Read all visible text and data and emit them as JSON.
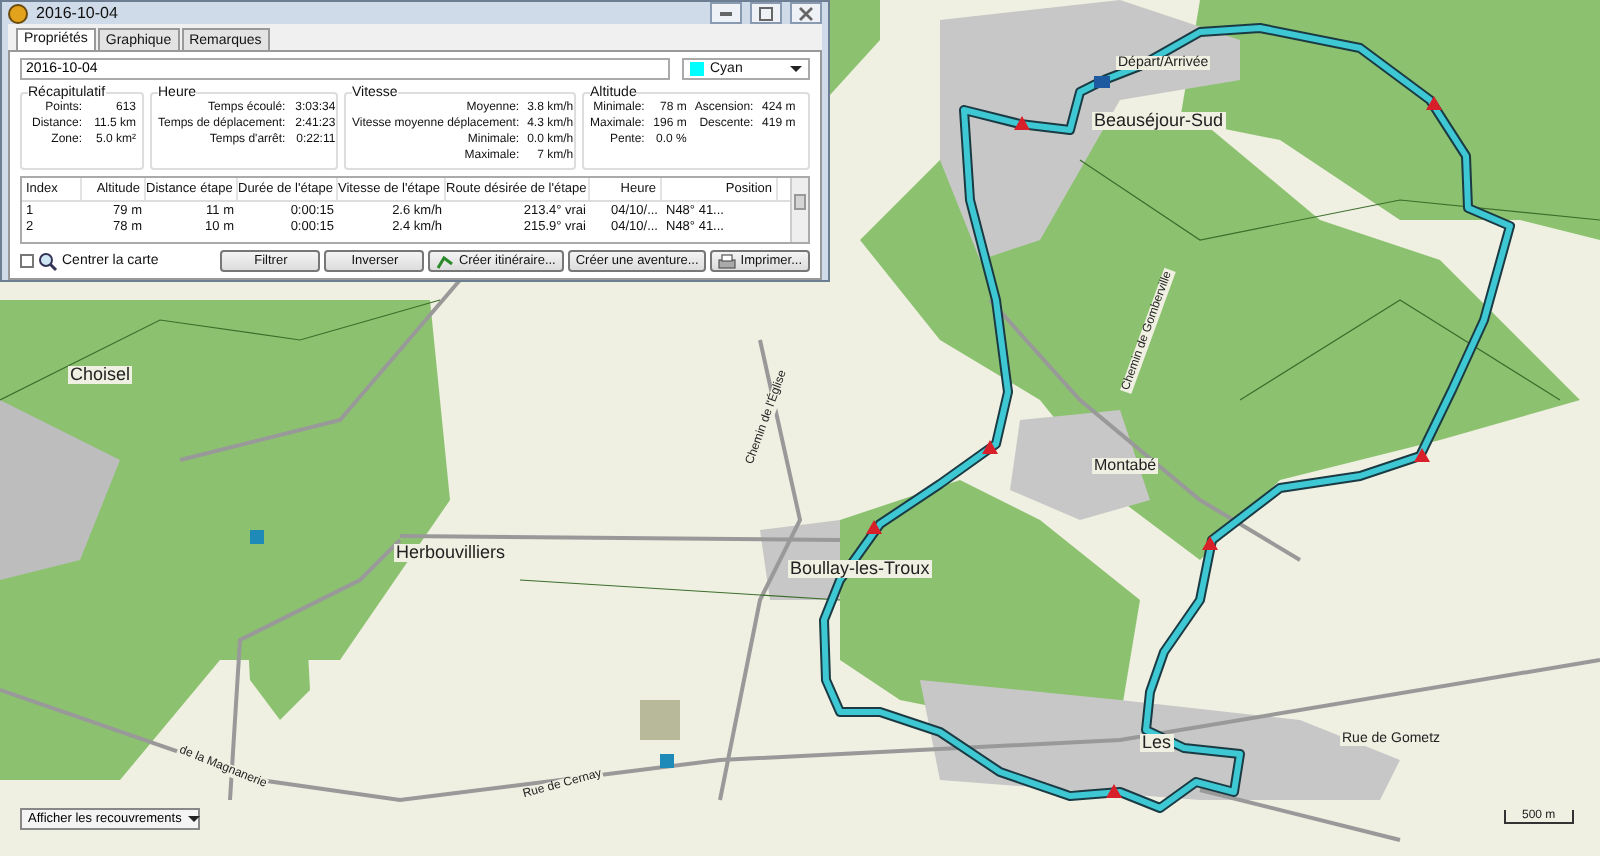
{
  "window": {
    "title": "2016-10-04"
  },
  "tabs": [
    {
      "label": "Propriétés",
      "selected": true
    },
    {
      "label": "Graphique",
      "selected": false
    },
    {
      "label": "Remarques",
      "selected": false
    }
  ],
  "name_field": {
    "value": "2016-10-04"
  },
  "color_dropdown": {
    "value": "Cyan",
    "color": "#00ffff"
  },
  "groups": [
    {
      "title": "Récapitulatif",
      "stats": [
        {
          "label": "Points:",
          "value": "613"
        },
        {
          "label": "Distance:",
          "value": "11.5 km"
        },
        {
          "label": "Zone:",
          "value": "5.0 km²"
        }
      ]
    },
    {
      "title": "Heure",
      "stats": [
        {
          "label": "Temps écoulé:",
          "value": "3:03:34"
        },
        {
          "label": "Temps de déplacement:",
          "value": "2:41:23"
        },
        {
          "label": "Temps d'arrêt:",
          "value": "0:22:11"
        }
      ]
    },
    {
      "title": "Vitesse",
      "stats": [
        {
          "label": "Moyenne:",
          "value": "3.8 km/h"
        },
        {
          "label": "Vitesse moyenne déplacement:",
          "value": "4.3 km/h"
        },
        {
          "label": "Minimale:",
          "value": "0.0 km/h"
        },
        {
          "label": "Maximale:",
          "value": "7 km/h"
        }
      ]
    },
    {
      "title": "Altitude",
      "stats": [
        {
          "label": "Minimale:",
          "value": "78 m"
        },
        {
          "label": "Maximale:",
          "value": "196 m"
        },
        {
          "label": "Pente:",
          "value": "0.0 %"
        },
        {
          "label": "Ascension:",
          "value": "424 m"
        },
        {
          "label": "Descente:",
          "value": "419 m"
        }
      ]
    }
  ],
  "table": {
    "columns": [
      "Index",
      "Altitude",
      "Distance étape",
      "Durée de l'étape",
      "Vitesse de l'étape",
      "Route désirée de l'étape",
      "Heure",
      "Position"
    ],
    "rows": [
      [
        "1",
        "79 m",
        "11 m",
        "0:00:15",
        "2.6 km/h",
        "213.4° vrai",
        "04/10/...",
        "N48° 41..."
      ],
      [
        "2",
        "78 m",
        "10 m",
        "0:00:15",
        "2.4 km/h",
        "215.9° vrai",
        "04/10/...",
        "N48° 41..."
      ]
    ]
  },
  "center_map": {
    "label": "Centrer la carte",
    "checked": false
  },
  "buttons": [
    "Filtrer",
    "Inverser",
    "Créer itinéraire...",
    "Créer une aventure...",
    "Imprimer..."
  ],
  "map": {
    "labels": [
      {
        "text": "Choisel"
      },
      {
        "text": "Herbouvilliers"
      },
      {
        "text": "Départ/Arrivée"
      },
      {
        "text": "Beauséjour-Sud"
      },
      {
        "text": "Montabé"
      },
      {
        "text": "Boullay-les-Troux"
      },
      {
        "text": "Les"
      },
      {
        "text": "Rue de Gometz"
      },
      {
        "text": "Chemin de l'Église"
      },
      {
        "text": "de la Magnanerie"
      },
      {
        "text": "Rue de Cernay"
      },
      {
        "text": "Chemin de Gomberville"
      }
    ],
    "scale": "500 m"
  },
  "overlay_dropdown": {
    "value": "Afficher les recouvrements"
  }
}
